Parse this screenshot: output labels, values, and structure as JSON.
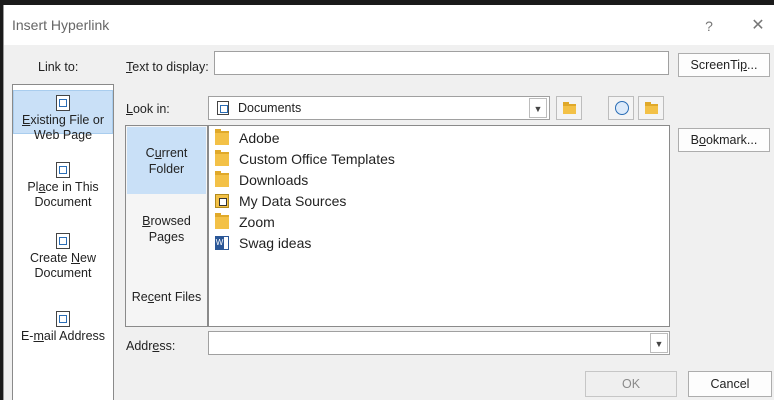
{
  "dialog": {
    "title": "Insert Hyperlink",
    "help": "?",
    "close": "✕"
  },
  "link_to": {
    "label": "Link to:",
    "items": [
      {
        "line1": "Existing File or",
        "line2": "Web Page",
        "icon": "existing-file-icon",
        "selected": true
      },
      {
        "line1": "Place in This",
        "line2": "Document",
        "icon": "place-in-document-icon",
        "selected": false
      },
      {
        "line1": "Create New",
        "line2": "Document",
        "icon": "new-document-icon",
        "selected": false
      },
      {
        "line1": "E-mail Address",
        "line2": "",
        "icon": "email-icon",
        "selected": false
      }
    ]
  },
  "text_to_display": {
    "label": "Text to display:",
    "value": ""
  },
  "screentip_button": "ScreenTip...",
  "look_in": {
    "label": "Look in:",
    "value": "Documents"
  },
  "places": [
    {
      "line1": "Current",
      "line2": "Folder",
      "selected": true
    },
    {
      "line1": "Browsed",
      "line2": "Pages",
      "selected": false
    },
    {
      "line1": "Recent Files",
      "line2": "",
      "selected": false
    }
  ],
  "files": [
    {
      "name": "Adobe",
      "icon": "folder-icon"
    },
    {
      "name": "Custom Office Templates",
      "icon": "folder-icon"
    },
    {
      "name": "Downloads",
      "icon": "folder-icon"
    },
    {
      "name": "My Data Sources",
      "icon": "data-sources-folder-icon"
    },
    {
      "name": "Zoom",
      "icon": "folder-icon"
    },
    {
      "name": "Swag ideas",
      "icon": "word-document-icon"
    }
  ],
  "bookmark_button": "Bookmark...",
  "address": {
    "label": "Address:",
    "value": ""
  },
  "buttons": {
    "ok": "OK",
    "cancel": "Cancel"
  },
  "colors": {
    "selection": "#c9e0f7",
    "dialog_bg": "#f0f0f0"
  }
}
